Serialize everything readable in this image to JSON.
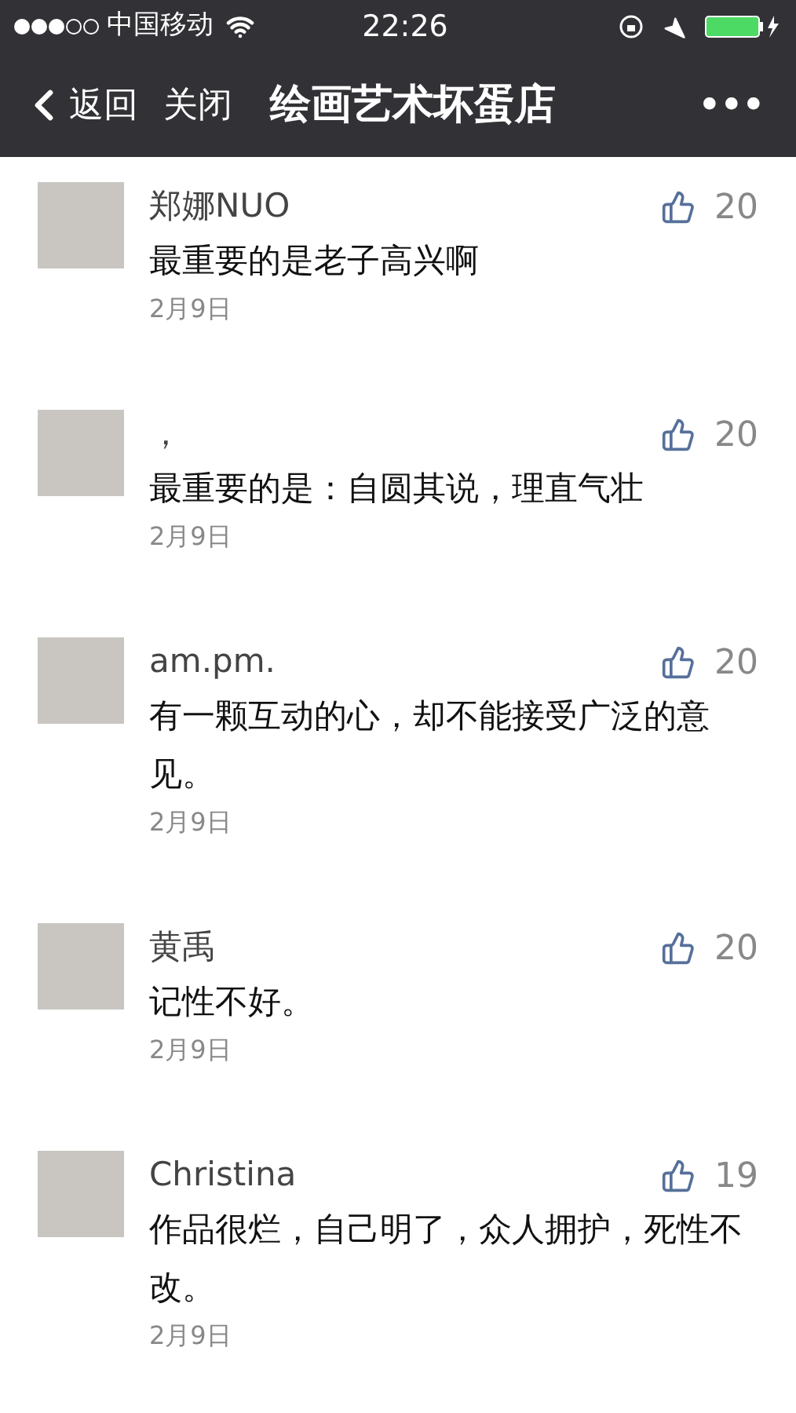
{
  "status_bar": {
    "carrier": "中国移动",
    "time": "22:26"
  },
  "nav": {
    "back": "返回",
    "close": "关闭",
    "title": "绘画艺术坏蛋店",
    "more": "•••"
  },
  "comments": [
    {
      "name": "郑娜NUO",
      "likes": "20",
      "text": "最重要的是老子高兴啊",
      "date": "2月9日"
    },
    {
      "name": "，",
      "likes": "20",
      "text": "最重要的是：自圆其说，理直气壮",
      "date": "2月9日"
    },
    {
      "name": "am.pm.",
      "likes": "20",
      "text": "有一颗互动的心，却不能接受广泛的意见。",
      "date": "2月9日"
    },
    {
      "name": "黄禹",
      "likes": "20",
      "text": "记性不好。",
      "date": "2月9日"
    },
    {
      "name": "Christina",
      "likes": "19",
      "text": "作品很烂，自己明了，众人拥护，死性不改。",
      "date": "2月9日"
    }
  ]
}
